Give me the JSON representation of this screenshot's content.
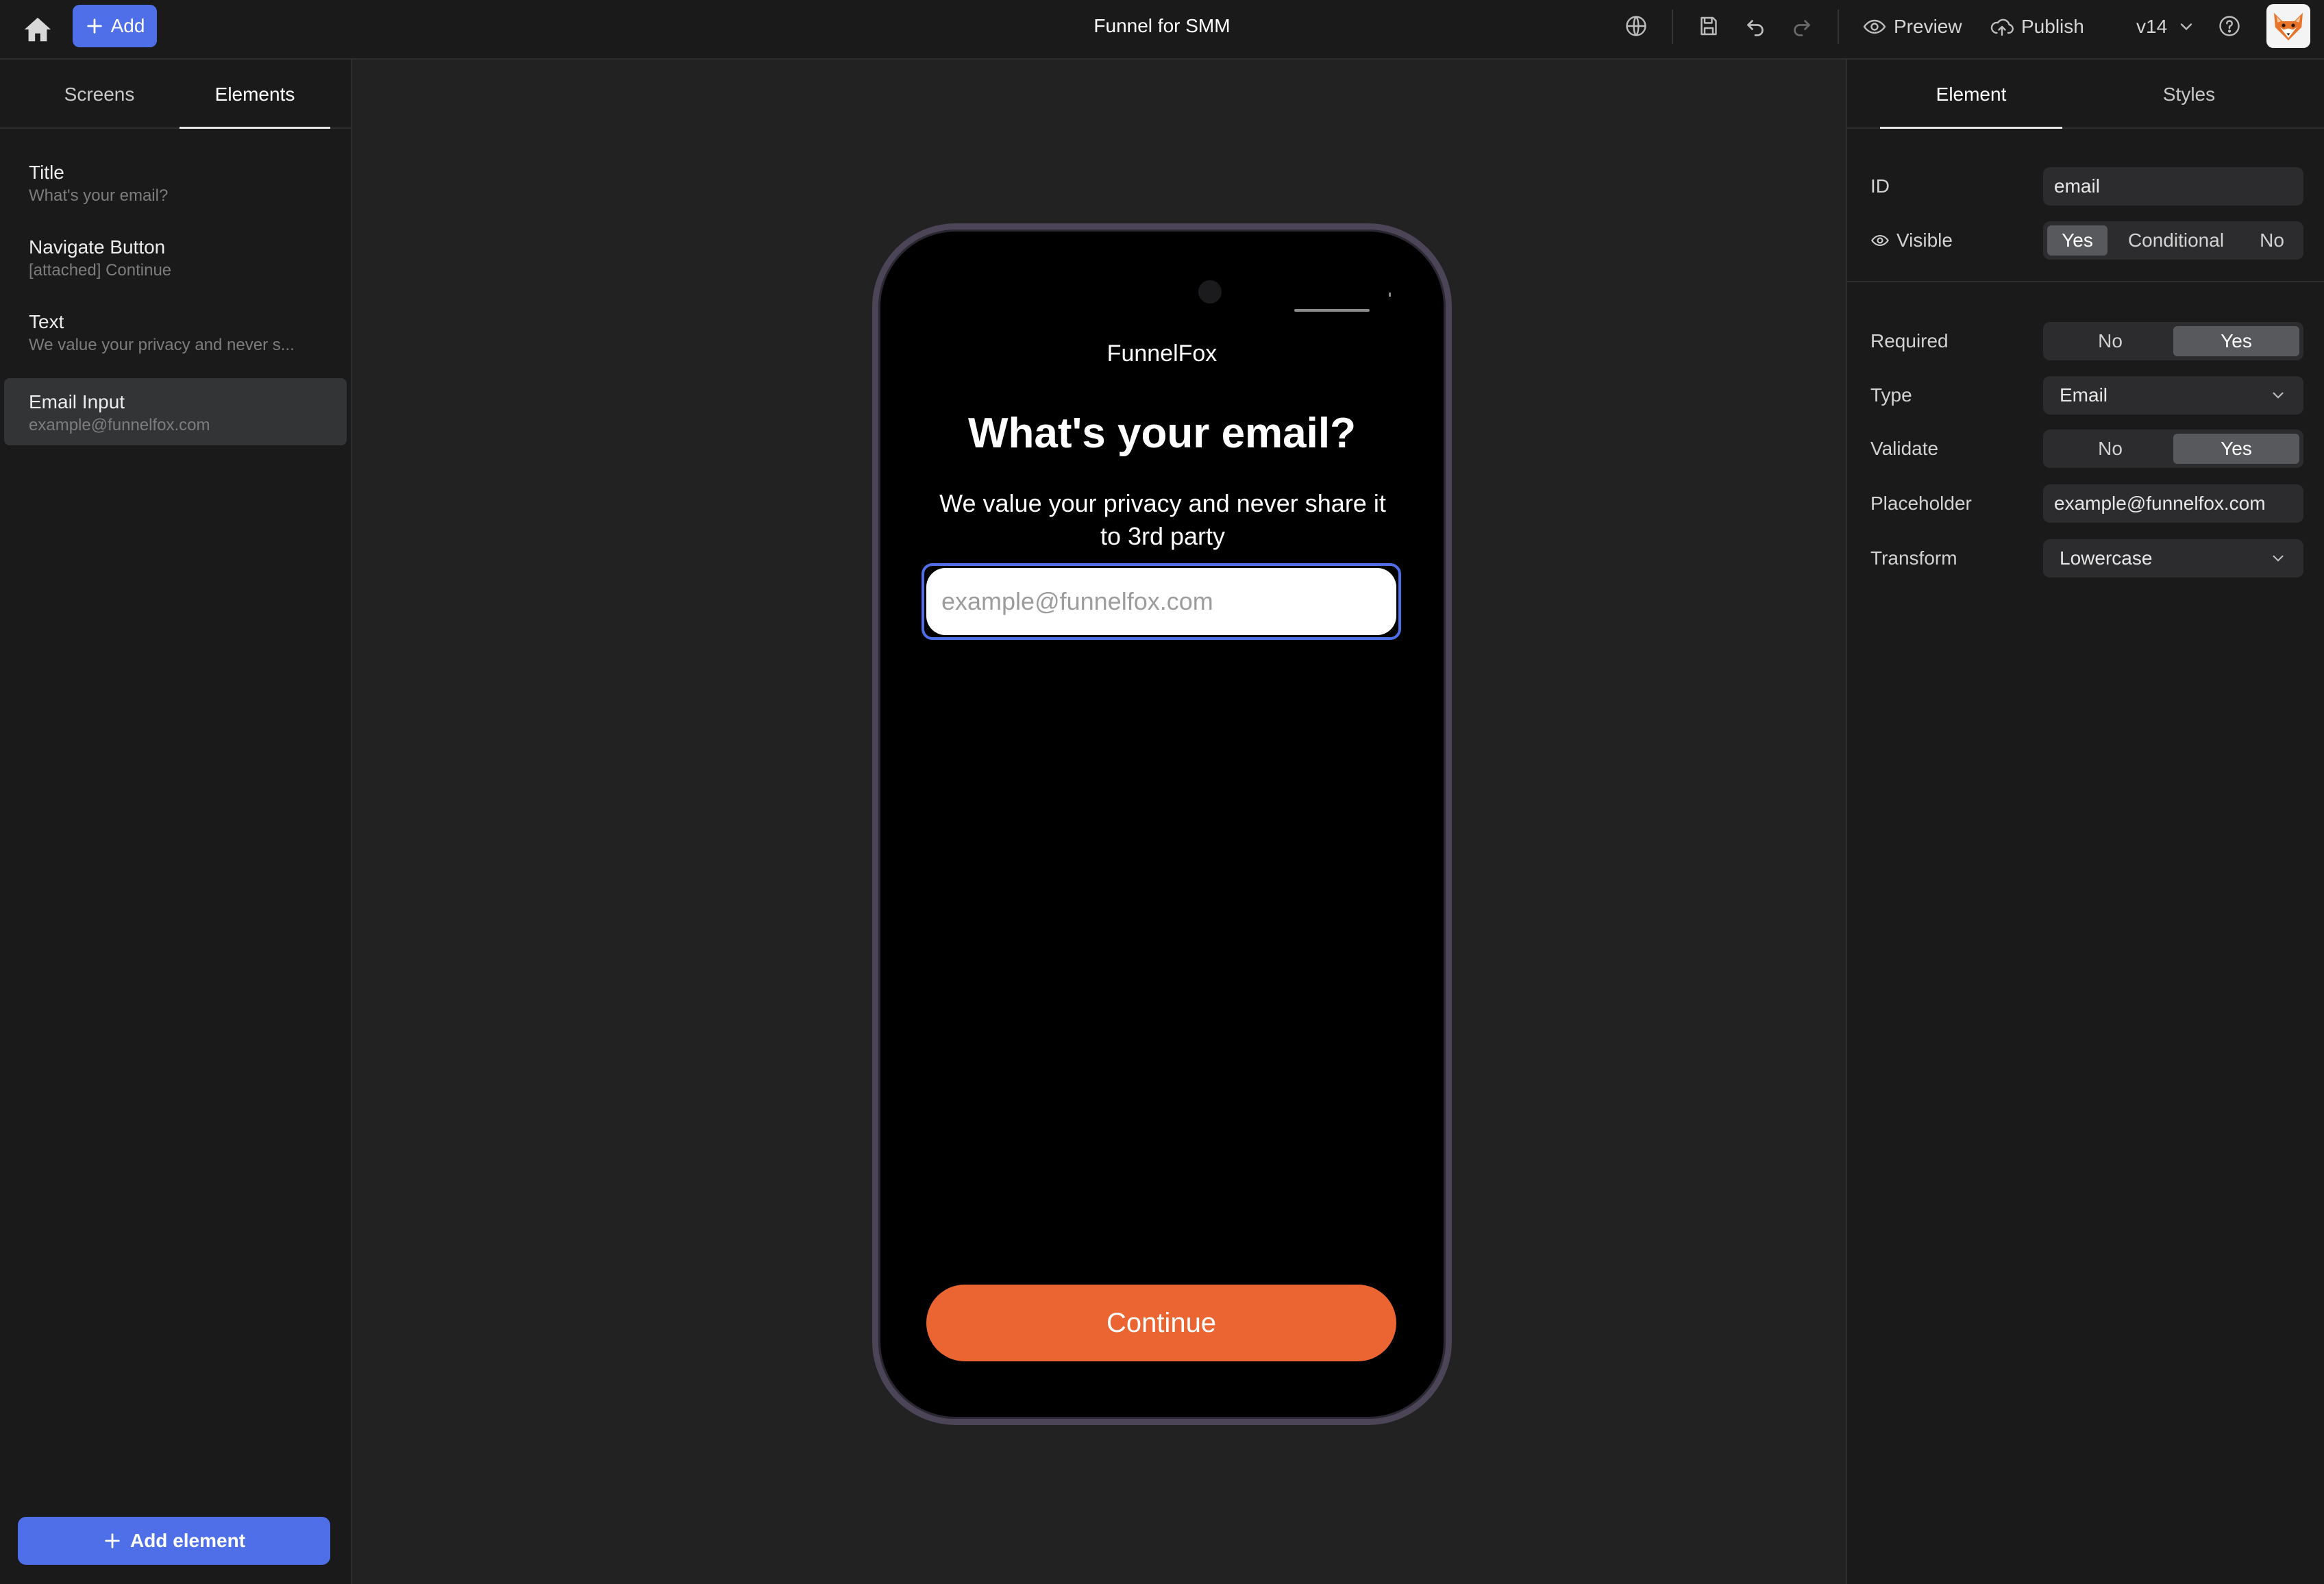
{
  "header": {
    "add_label": "Add",
    "title": "Funnel for SMM",
    "preview_label": "Preview",
    "publish_label": "Publish",
    "version": "v14"
  },
  "left_panel": {
    "tabs": [
      {
        "label": "Screens",
        "active": false
      },
      {
        "label": "Elements",
        "active": true
      }
    ],
    "elements": [
      {
        "title": "Title",
        "subtitle": "What's your email?"
      },
      {
        "title": "Navigate Button",
        "subtitle": "[attached] Continue"
      },
      {
        "title": "Text",
        "subtitle": "We value your privacy and never s..."
      },
      {
        "title": "Email Input",
        "subtitle": "example@funnelfox.com",
        "selected": true
      }
    ],
    "add_element_label": "Add element"
  },
  "preview": {
    "brand": "FunnelFox",
    "title": "What's your email?",
    "text": "We value your privacy and never share it to 3rd party",
    "input_placeholder": "example@funnelfox.com",
    "cta_label": "Continue",
    "cta_color": "#ea6531"
  },
  "right_panel": {
    "tabs": [
      {
        "label": "Element",
        "active": true
      },
      {
        "label": "Styles",
        "active": false
      }
    ],
    "id_label": "ID",
    "id_value": "email",
    "visible_label": "Visible",
    "visible_options": [
      "Yes",
      "Conditional",
      "No"
    ],
    "visible_selected": "Yes",
    "required_label": "Required",
    "required_options": [
      "No",
      "Yes"
    ],
    "required_selected": "Yes",
    "type_label": "Type",
    "type_value": "Email",
    "validate_label": "Validate",
    "validate_options": [
      "No",
      "Yes"
    ],
    "validate_selected": "Yes",
    "placeholder_label": "Placeholder",
    "placeholder_value": "example@funnelfox.com",
    "transform_label": "Transform",
    "transform_value": "Lowercase"
  },
  "colors": {
    "accent": "#4f6fe8",
    "background": "#222222",
    "panel": "#1a1a1a"
  },
  "icons": [
    "home-icon",
    "plus-icon",
    "globe-icon",
    "save-icon",
    "undo-icon",
    "redo-icon",
    "eye-icon",
    "cloud-upload-icon",
    "chevron-down-icon",
    "help-icon",
    "fox-avatar-icon"
  ]
}
